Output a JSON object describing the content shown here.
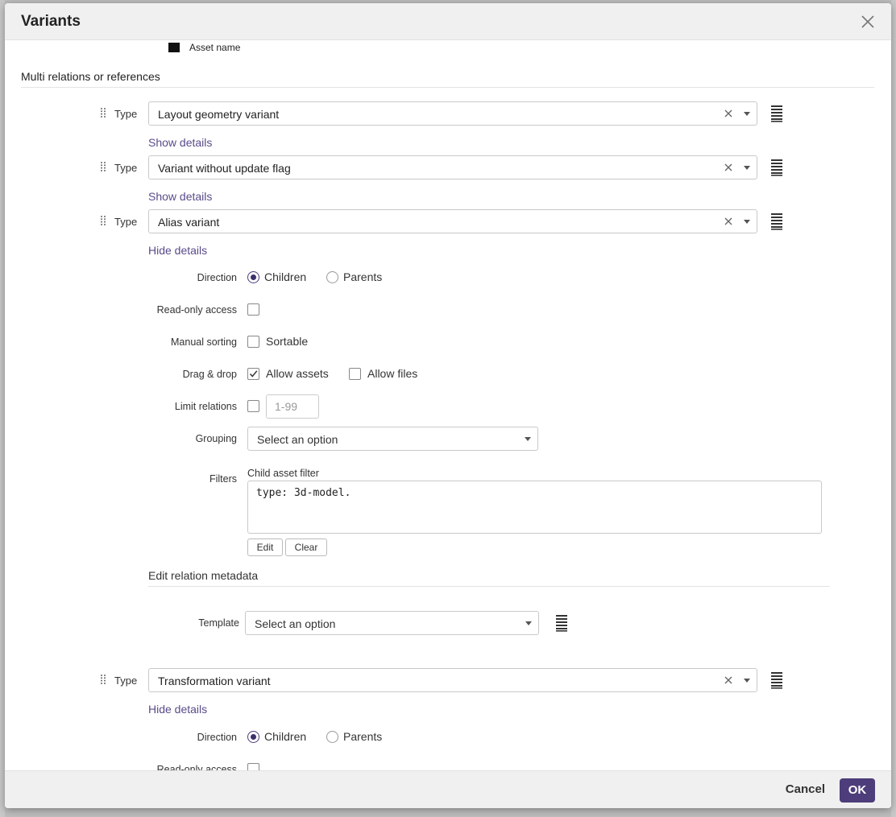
{
  "dialog": {
    "title": "Variants",
    "asset_name_label": "Asset name",
    "section_title": "Multi relations or references"
  },
  "types": [
    {
      "label": "Type",
      "value": "Layout geometry variant",
      "details_link": "Show details"
    },
    {
      "label": "Type",
      "value": "Variant without update flag",
      "details_link": "Show details"
    },
    {
      "label": "Type",
      "value": "Alias variant",
      "details_link": "Hide details"
    },
    {
      "label": "Type",
      "value": "Transformation variant",
      "details_link": "Hide details"
    }
  ],
  "details": {
    "direction_label": "Direction",
    "direction_options": [
      "Children",
      "Parents"
    ],
    "direction_selected": "Children",
    "readonly_label": "Read-only access",
    "readonly_checked": false,
    "manual_sorting_label": "Manual sorting",
    "sortable_label": "Sortable",
    "sortable_checked": false,
    "dragdrop_label": "Drag & drop",
    "allow_assets_label": "Allow assets",
    "allow_assets_checked": true,
    "allow_files_label": "Allow files",
    "allow_files_checked": false,
    "limit_label": "Limit relations",
    "limit_placeholder": "1-99",
    "grouping_label": "Grouping",
    "grouping_value": "Select an option",
    "filters_label": "Filters",
    "child_filter_label": "Child asset filter",
    "child_filter_value": "type: 3d-model.",
    "edit_button": "Edit",
    "clear_button": "Clear",
    "relation_metadata_title": "Edit relation metadata",
    "template_label": "Template",
    "template_value": "Select an option"
  },
  "details2": {
    "direction_label": "Direction",
    "direction_options": [
      "Children",
      "Parents"
    ],
    "direction_selected": "Children",
    "readonly_label": "Read-only access"
  },
  "footer": {
    "cancel_label": "Cancel",
    "ok_label": "OK"
  },
  "colors": {
    "accent": "#4d3d7a",
    "link": "#5a4b8a",
    "header_bg": "#f0f0f0"
  }
}
